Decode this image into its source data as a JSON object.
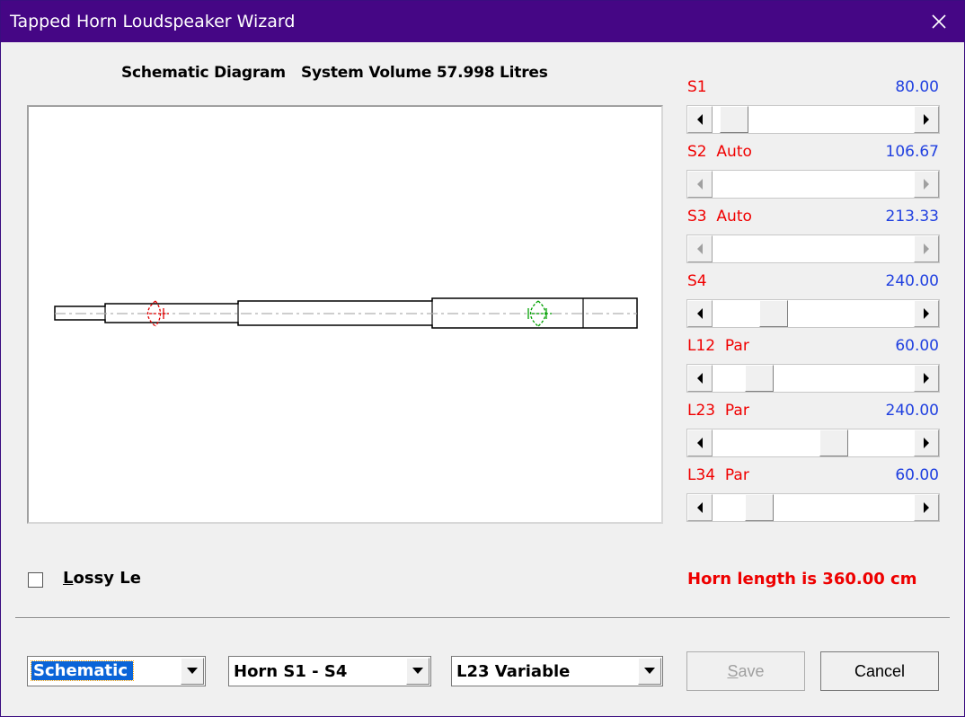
{
  "window": {
    "title": "Tapped Horn Loudspeaker Wizard"
  },
  "diagram": {
    "header": "Schematic Diagram   System Volume 57.998 Litres"
  },
  "sliders": [
    {
      "label": "S1",
      "value": "80.00",
      "position": 0.04
    },
    {
      "label": "S2  Auto",
      "value": "106.67",
      "position": 0.0,
      "disabled": true
    },
    {
      "label": "S3  Auto",
      "value": "213.33",
      "position": 0.0,
      "disabled": true
    },
    {
      "label": "S4",
      "value": "240.00",
      "position": 0.27
    },
    {
      "label": "L12  Par",
      "value": "60.00",
      "position": 0.19
    },
    {
      "label": "L23  Par",
      "value": "240.00",
      "position": 0.62
    },
    {
      "label": "L34  Par",
      "value": "60.00",
      "position": 0.19
    }
  ],
  "lossy": {
    "label_underline": "L",
    "label_rest": "ossy Le",
    "checked": false
  },
  "horn_length": "Horn length is 360.00 cm",
  "combos": [
    {
      "value": "Schematic",
      "focused": true
    },
    {
      "value": "Horn S1 - S4",
      "focused": false
    },
    {
      "value": "L23 Variable",
      "focused": false
    }
  ],
  "buttons": {
    "save_underline": "S",
    "save_rest": "ave",
    "cancel": "Cancel"
  },
  "colors": {
    "title_bar": "#450685",
    "label_red": "#f00000",
    "value_blue": "#2040e0",
    "driver_red": "#e00000",
    "driver_green": "#00a000"
  }
}
